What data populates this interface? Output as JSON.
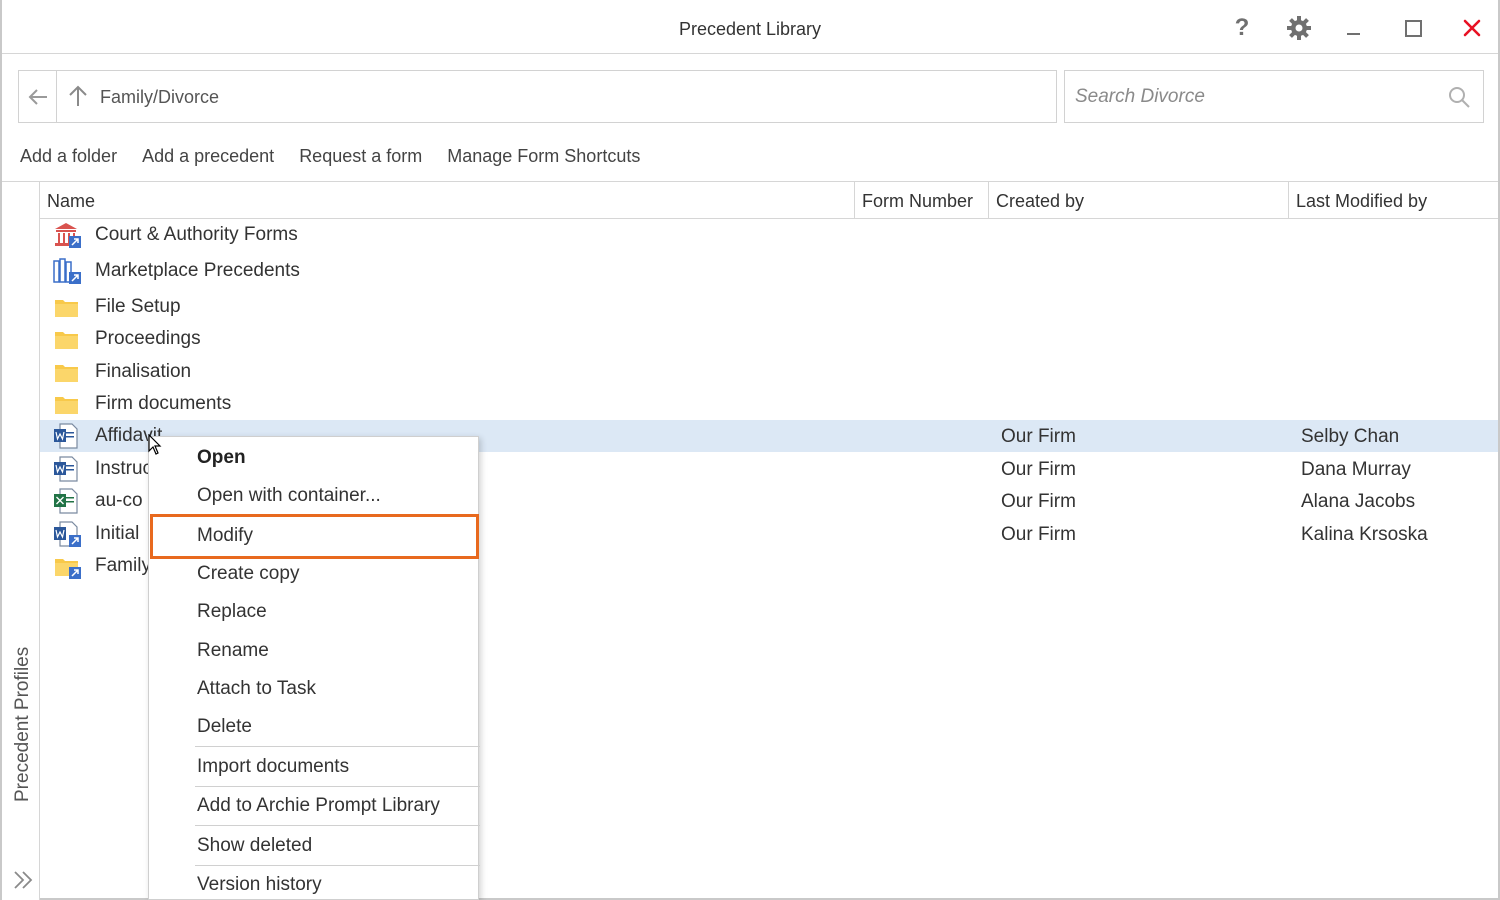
{
  "window": {
    "title": "Precedent Library"
  },
  "titlebar_icons": [
    "help-icon",
    "gear-icon",
    "minimize-icon",
    "maximize-icon",
    "close-icon"
  ],
  "titlebar": {
    "help_glyph": "?"
  },
  "address": {
    "path": "Family/Divorce"
  },
  "search": {
    "placeholder": "Search Divorce"
  },
  "actions": {
    "add_folder": "Add a folder",
    "add_precedent": "Add a precedent",
    "request_form": "Request a form",
    "manage_shortcuts": "Manage Form Shortcuts"
  },
  "sidebar": {
    "label": "Precedent Profiles"
  },
  "table": {
    "columns": {
      "name": "Name",
      "form_number": "Form Number",
      "created_by": "Created by",
      "last_modified_by": "Last Modified by"
    },
    "rows": [
      {
        "icon": "court-forms-icon",
        "name": "Court & Authority Forms",
        "created_by": "",
        "modified_by": ""
      },
      {
        "icon": "marketplace-icon",
        "name": "Marketplace Precedents",
        "created_by": "",
        "modified_by": ""
      },
      {
        "icon": "folder-icon",
        "name": "File Setup",
        "created_by": "",
        "modified_by": ""
      },
      {
        "icon": "folder-icon",
        "name": "Proceedings",
        "created_by": "",
        "modified_by": ""
      },
      {
        "icon": "folder-icon",
        "name": "Finalisation",
        "created_by": "",
        "modified_by": ""
      },
      {
        "icon": "folder-icon",
        "name": "Firm documents",
        "created_by": "",
        "modified_by": ""
      },
      {
        "icon": "word-doc-icon",
        "name": "Affidavit",
        "created_by": "Our Firm",
        "modified_by": "Selby Chan"
      },
      {
        "icon": "word-doc-icon",
        "name": "Instruc",
        "created_by": "Our Firm",
        "modified_by": "Dana Murray"
      },
      {
        "icon": "excel-doc-icon",
        "name": "au-co",
        "created_by": "Our Firm",
        "modified_by": "Alana Jacobs"
      },
      {
        "icon": "word-shortcut-icon",
        "name": "Initial",
        "created_by": "Our Firm",
        "modified_by": "Kalina Krsoska"
      },
      {
        "icon": "folder-shortcut-icon",
        "name": "Family",
        "created_by": "",
        "modified_by": ""
      }
    ]
  },
  "context_menu": {
    "open": "Open",
    "open_with_container": "Open with container...",
    "modify": "Modify",
    "create_copy": "Create copy",
    "replace": "Replace",
    "rename": "Rename",
    "attach_to_task": "Attach to Task",
    "delete": "Delete",
    "import_documents": "Import documents",
    "add_to_archie": "Add to Archie Prompt Library",
    "show_deleted": "Show deleted",
    "version_history": "Version history"
  },
  "colors": {
    "selection": "#dce8f5",
    "highlight_border": "#e8691e",
    "close_red": "#e81123",
    "folder_yellow": "#f8c94a",
    "word_blue": "#2b579a",
    "excel_green": "#217346"
  }
}
